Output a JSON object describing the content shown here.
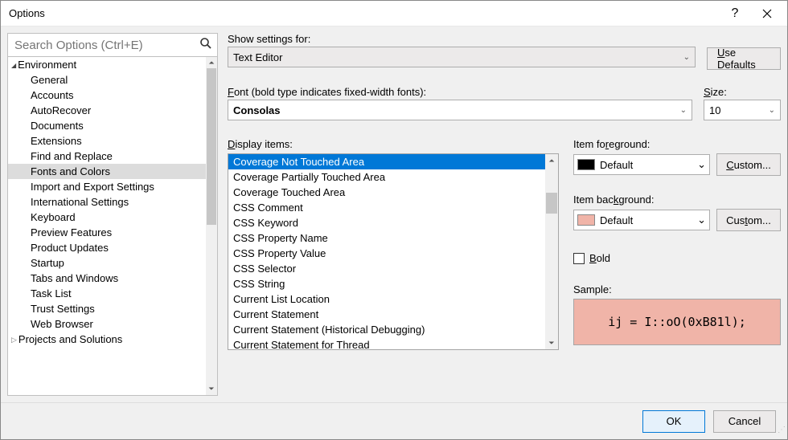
{
  "window": {
    "title": "Options"
  },
  "search": {
    "placeholder": "Search Options (Ctrl+E)"
  },
  "tree": {
    "env_label": "Environment",
    "items": [
      "General",
      "Accounts",
      "AutoRecover",
      "Documents",
      "Extensions",
      "Find and Replace",
      "Fonts and Colors",
      "Import and Export Settings",
      "International Settings",
      "Keyboard",
      "Preview Features",
      "Product Updates",
      "Startup",
      "Tabs and Windows",
      "Task List",
      "Trust Settings",
      "Web Browser"
    ],
    "selected_index": 6,
    "collapsed_label": "Projects and Solutions"
  },
  "settings": {
    "show_settings_label": "Show settings for:",
    "show_settings_value": "Text Editor",
    "use_defaults_label": "Use Defaults",
    "font_label": "Font (bold type indicates fixed-width fonts):",
    "font_value": "Consolas",
    "size_label": "Size:",
    "size_value": "10",
    "display_items_label": "Display items:",
    "display_items": [
      "Coverage Not Touched Area",
      "Coverage Partially Touched Area",
      "Coverage Touched Area",
      "CSS Comment",
      "CSS Keyword",
      "CSS Property Name",
      "CSS Property Value",
      "CSS Selector",
      "CSS String",
      "Current List Location",
      "Current Statement",
      "Current Statement (Historical Debugging)",
      "Current Statement for Thread"
    ],
    "display_selected_index": 0,
    "fg_label": "Item foreground:",
    "fg_value": "Default",
    "fg_color": "#000000",
    "bg_label": "Item background:",
    "bg_value": "Default",
    "bg_color": "#f0b4a8",
    "custom_label": "Custom...",
    "bold_label": "Bold",
    "sample_label": "Sample:",
    "sample_text": "ij = I::oO(0xB81l);"
  },
  "buttons": {
    "ok": "OK",
    "cancel": "Cancel"
  }
}
